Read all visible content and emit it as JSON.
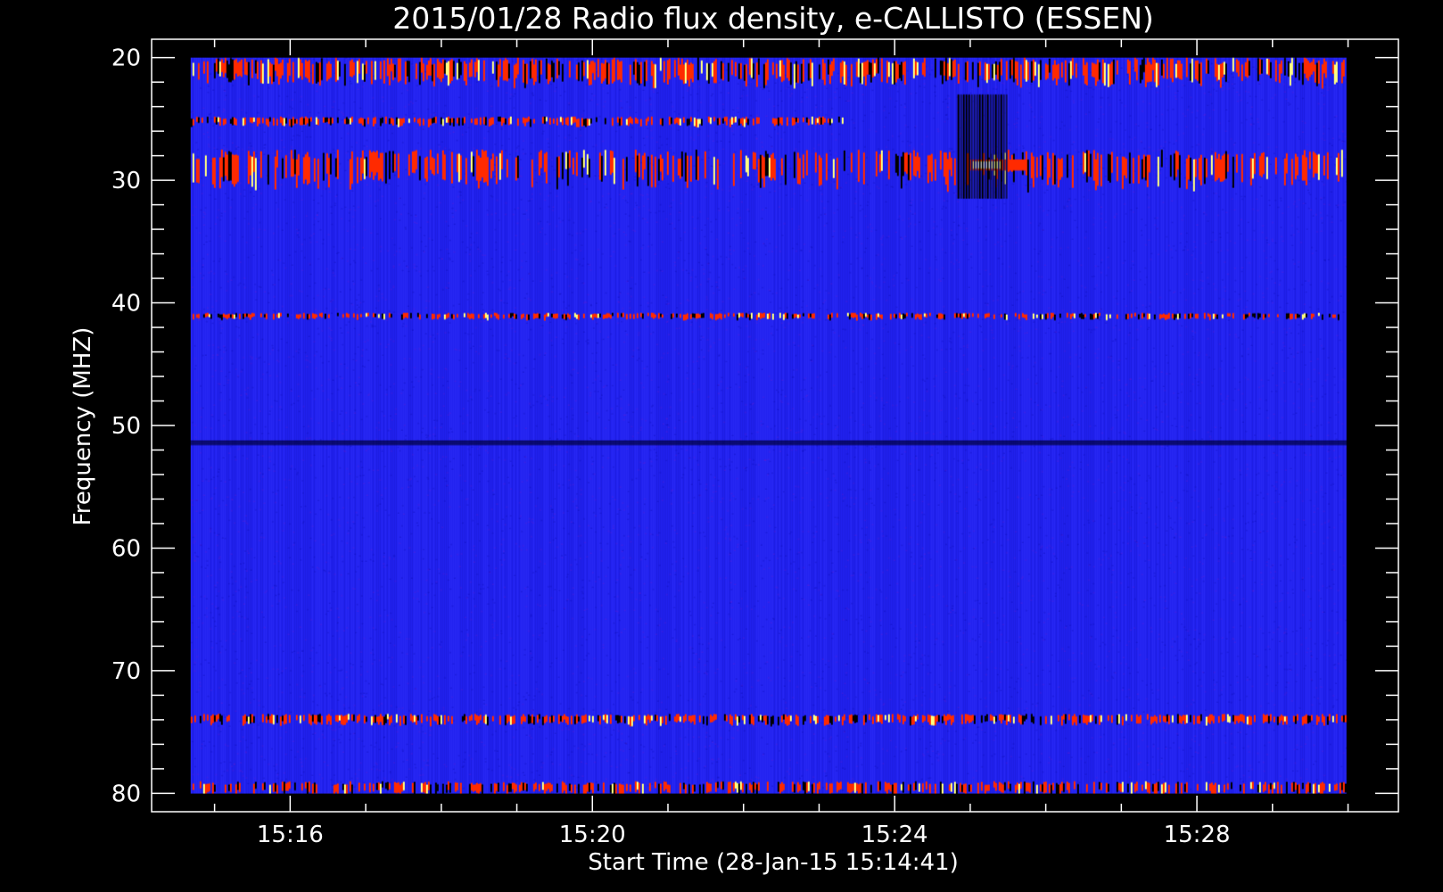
{
  "chart_data": {
    "type": "heatmap",
    "title": "2015/01/28  Radio flux density, e-CALLISTO (ESSEN)",
    "xlabel": "Start Time (28-Jan-15 15:14:41)",
    "ylabel": "Frequency (MHZ)",
    "x_unit": "time of day",
    "x_range": [
      "15:14:41",
      "15:29:59"
    ],
    "xlim": [
      "15:14:10",
      "15:30:40"
    ],
    "x_ticks": [
      "15:16",
      "15:20",
      "15:24",
      "15:28"
    ],
    "y_ticks": [
      20,
      30,
      40,
      50,
      60,
      70,
      80
    ],
    "ylim": [
      18.5,
      81.5
    ],
    "y_range": [
      20,
      80
    ],
    "y_inverted": true,
    "colormap": [
      "#000000",
      "#1a1aff",
      "#ff2a00",
      "#ffff80",
      "#ffffff"
    ],
    "background_color": "#2222f0",
    "frame_color": "#ffffff",
    "features": [
      {
        "kind": "band",
        "freq_range": [
          20,
          22
        ],
        "time_range": [
          "15:14:41",
          "15:29:59"
        ],
        "level": 0.75
      },
      {
        "kind": "band",
        "freq_range": [
          24.8,
          25.5
        ],
        "time_range": [
          "15:14:41",
          "15:23:20"
        ],
        "level": 0.7
      },
      {
        "kind": "band",
        "freq_range": [
          27.5,
          30.2
        ],
        "time_range": [
          "15:14:41",
          "15:29:59"
        ],
        "level": 0.55
      },
      {
        "kind": "burst",
        "freq_range": [
          28.3,
          29.2
        ],
        "time_range": [
          "15:25:00",
          "15:25:45"
        ],
        "level": 1.0
      },
      {
        "kind": "dropout",
        "freq_range": [
          23,
          31.5
        ],
        "time_range": [
          "15:24:50",
          "15:25:30"
        ],
        "level": 0.0
      },
      {
        "kind": "band",
        "freq_range": [
          40.8,
          41.3
        ],
        "time_range": [
          "15:14:41",
          "15:29:59"
        ],
        "level": 0.65
      },
      {
        "kind": "line",
        "freq_range": [
          51.2,
          51.6
        ],
        "time_range": [
          "15:14:41",
          "15:29:59"
        ],
        "level": 0.15
      },
      {
        "kind": "band",
        "freq_range": [
          73.5,
          74.3
        ],
        "time_range": [
          "15:14:41",
          "15:29:59"
        ],
        "level": 0.7
      },
      {
        "kind": "band",
        "freq_range": [
          79,
          80
        ],
        "time_range": [
          "15:14:41",
          "15:29:59"
        ],
        "level": 0.6
      }
    ]
  }
}
